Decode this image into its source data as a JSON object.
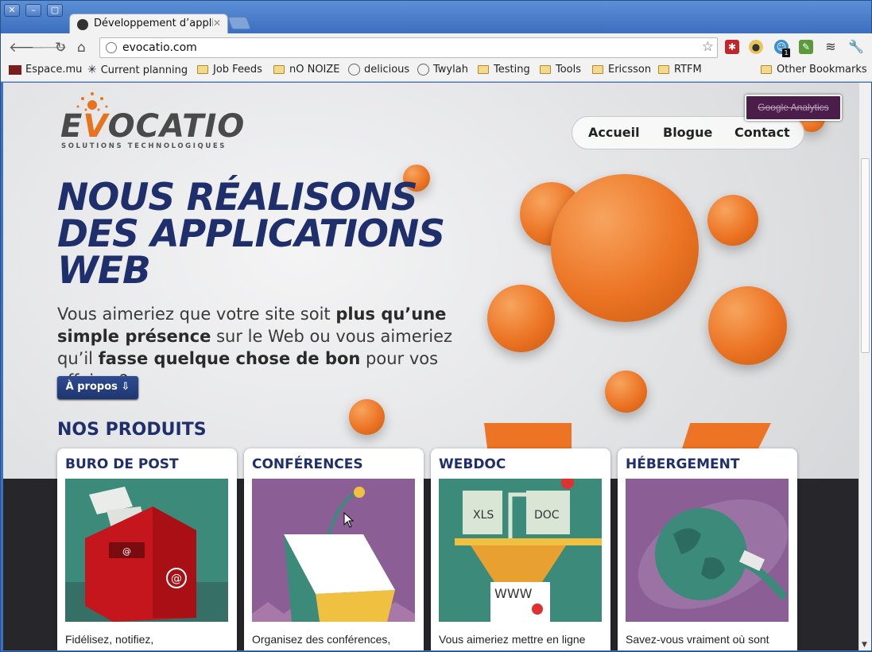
{
  "browser": {
    "tab_title": "Développement d’applicat",
    "url": "evocatio.com",
    "window_buttons": [
      "close-icon",
      "minimize-icon",
      "maximize-icon"
    ]
  },
  "bookmarks": [
    {
      "label": "Espace.mu",
      "icon": "site-icon"
    },
    {
      "label": "Current planning",
      "icon": "site-icon"
    },
    {
      "label": "Job Feeds",
      "icon": "folder-icon"
    },
    {
      "label": "nO NOIZE",
      "icon": "folder-icon"
    },
    {
      "label": "delicious",
      "icon": "globe-icon"
    },
    {
      "label": "Twylah",
      "icon": "globe-icon"
    },
    {
      "label": "Testing",
      "icon": "folder-icon"
    },
    {
      "label": "Tools",
      "icon": "folder-icon"
    },
    {
      "label": "Ericsson",
      "icon": "folder-icon"
    },
    {
      "label": "RTFM",
      "icon": "folder-icon"
    }
  ],
  "other_bookmarks": "Other Bookmarks",
  "extension_badge": "1",
  "site": {
    "logo_text_pre": "E",
    "logo_text_v": "V",
    "logo_text_post": "OCATIO",
    "logo_sub": "SOLUTIONS TECHNOLOGIQUES",
    "ga_button": "Google Analytics",
    "nav": [
      "Accueil",
      "Blogue",
      "Contact"
    ],
    "headline": [
      "NOUS RÉALISONS",
      "DES APPLICATIONS",
      "WEB"
    ],
    "intro": {
      "p1": "Vous aimeriez que votre site soit ",
      "b1": "plus qu’une simple présence",
      "p2": " sur le Web ou vous aimeriez qu’il ",
      "b2": "fasse quelque chose de bon",
      "p3": " pour vos affaires?"
    },
    "about_button": "À propos ⇩",
    "products_heading": "NOS PRODUITS",
    "products": [
      {
        "title": "BURO DE POST",
        "text": "Fidélisez, notifiez,"
      },
      {
        "title": "CONFÉRENCES",
        "text": "Organisez des conférences,"
      },
      {
        "title": "WEBDOC",
        "text": "Vous aimeriez mettre en ligne"
      },
      {
        "title": "HÉBERGEMENT",
        "text": "Savez-vous vraiment où sont"
      }
    ],
    "webdoc_labels": [
      "XLS",
      "DOC",
      "WWW"
    ],
    "mailbox_symbol": "@"
  },
  "colors": {
    "navy": "#1f2f6b",
    "orange": "#ec7424",
    "dark": "#27262b"
  }
}
